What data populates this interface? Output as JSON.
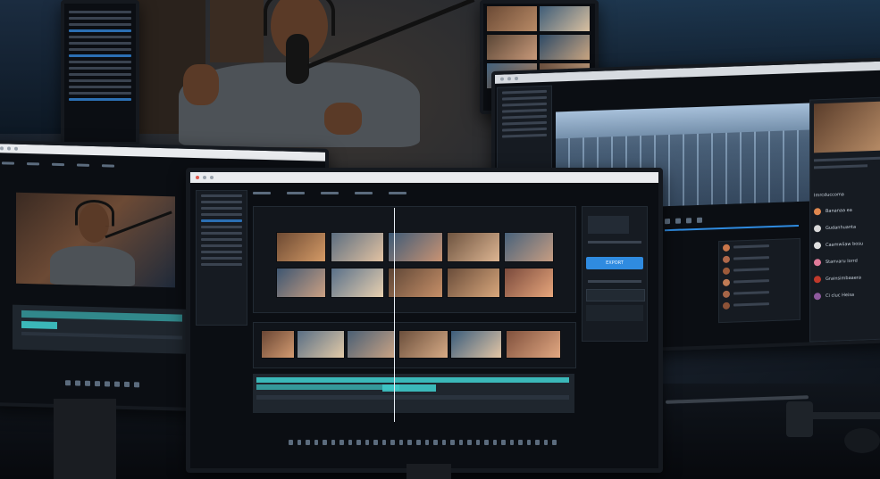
{
  "scene": {
    "description_alt": "",
    "colors": {
      "accent": "#2f8be0",
      "teal": "#3ec9c9",
      "panel": "#161b22",
      "screen_bg": "#0b0e13"
    }
  },
  "main_monitor": {
    "export_button_label": "EXPORT",
    "chat_items": [],
    "thumbnail_rows": 2,
    "timeline_clip_color": "#3ec9c9"
  },
  "right_monitor": {
    "chat_list": [
      {
        "text": "Bananaa ea",
        "avatar_color": "#e0884f"
      },
      {
        "text": "Gudanhuanta",
        "avatar_color": "#d9d9d9"
      },
      {
        "text": "Caamwiiaw bosu",
        "avatar_color": "#e0e0e0"
      },
      {
        "text": "Stanvaru lorrd",
        "avatar_color": "#e07b9a"
      },
      {
        "text": "Grainsimbaaera",
        "avatar_color": "#c0392b"
      },
      {
        "text": "Ci cluc Heisa",
        "avatar_color": "#8e5a9e"
      }
    ],
    "header_label": "Imrcduccoma"
  },
  "taskbar": {
    "icons": [
      "start-icon",
      "search-icon",
      "folder-icon",
      "browser-icon",
      "mail-icon",
      "store-icon",
      "edit-icon",
      "media-icon",
      "settings-icon",
      "app-icon",
      "app-icon",
      "app-icon",
      "app-icon",
      "app-icon",
      "app-icon",
      "app-icon",
      "app-icon",
      "app-icon",
      "app-icon",
      "app-icon",
      "app-icon",
      "app-icon",
      "app-icon",
      "app-icon",
      "app-icon",
      "app-icon",
      "app-icon",
      "app-icon",
      "app-icon",
      "app-icon",
      "app-icon",
      "app-icon"
    ]
  }
}
